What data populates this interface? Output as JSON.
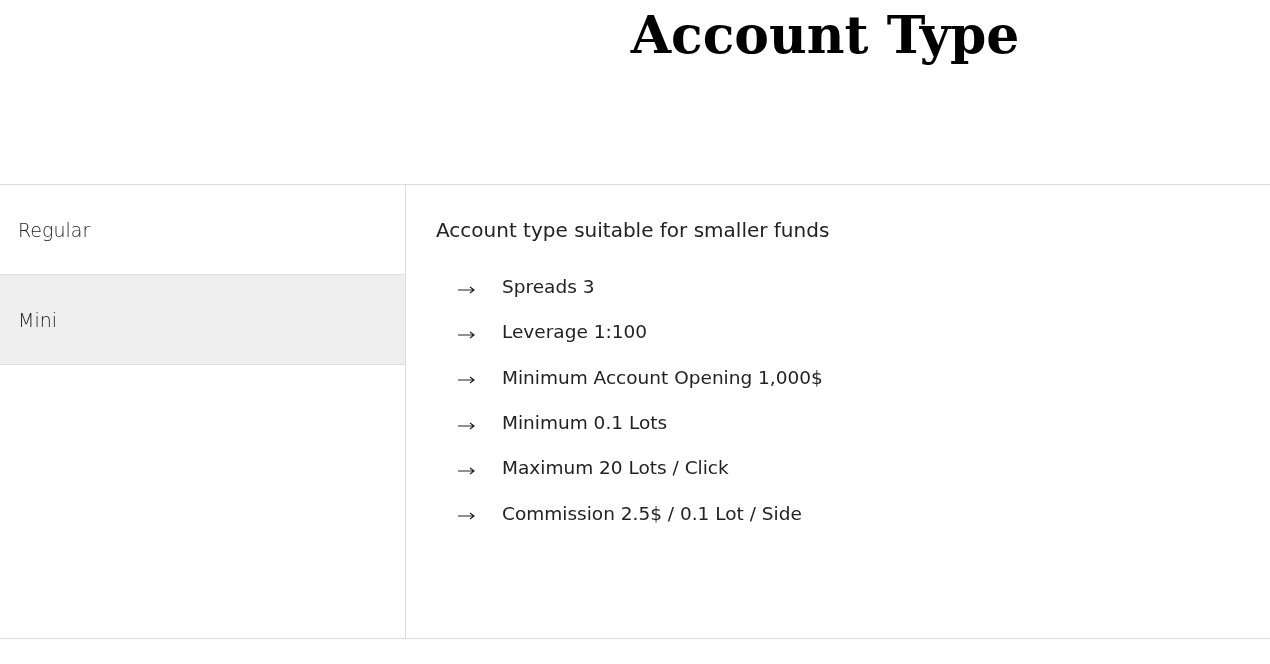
{
  "title": "Account Type",
  "tabs": [
    {
      "label": "Regular",
      "selected": false
    },
    {
      "label": "Mini",
      "selected": true
    }
  ],
  "panel": {
    "heading": "Account type suitable for smaller funds",
    "features": [
      "Spreads 3",
      "Leverage 1:100",
      "Minimum Account Opening 1,000$",
      "Minimum 0.1 Lots",
      "Maximum 20 Lots / Click",
      "Commission 2.5$ / 0.1 Lot / Side"
    ]
  }
}
